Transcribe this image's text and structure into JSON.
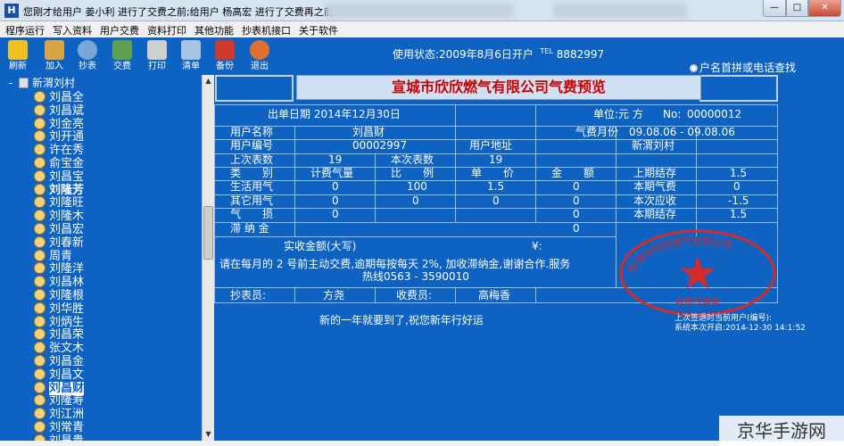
{
  "window": {
    "title": "您刚才给用户 姜小利 进行了交费之前;给用户 杨高宏 进行了交费再之前:",
    "min": "—",
    "max": "□",
    "close": "✕"
  },
  "menu": [
    "程序运行",
    "写入资料",
    "用户交费",
    "资料打印",
    "其他功能",
    "抄表机接口",
    "关于软件"
  ],
  "toolbar": [
    {
      "label": "刷新",
      "icon": "lightbulb-icon",
      "color": "#f0c020"
    },
    {
      "label": "加入",
      "icon": "add-user-icon",
      "color": "#d9a441"
    },
    {
      "label": "抄表",
      "icon": "meter-icon",
      "color": "#7aa7d6"
    },
    {
      "label": "交费",
      "icon": "calculator-icon",
      "color": "#5f9f4f"
    },
    {
      "label": "打印",
      "icon": "printer-icon",
      "color": "#cfcfcf"
    },
    {
      "label": "清单",
      "icon": "list-icon",
      "color": "#a9c3e3"
    },
    {
      "label": "备份",
      "icon": "backup-icon",
      "color": "#cf3a2a"
    },
    {
      "label": "退出",
      "icon": "exit-icon",
      "color": "#e07030"
    }
  ],
  "status": {
    "text": "使用状态:2009年8月6日开户",
    "tel_label": "TEL",
    "phone": "8882997"
  },
  "search_option": "户名首拼或电话查找",
  "tree": {
    "root": "新渭刘村",
    "expander": "-",
    "items": [
      "刘昌全",
      "刘昌斌",
      "刘金亮",
      "刘开通",
      "许在秀",
      "俞宝金",
      "刘昌宝",
      "刘隆芳",
      "刘隆旺",
      "刘隆木",
      "刘昌宏",
      "刘春新",
      "周青",
      "刘隆洋",
      "刘昌林",
      "刘隆根",
      "刘华胜",
      "刘炳生",
      "刘昌荣",
      "张文木",
      "刘昌金",
      "刘昌文",
      "刘昌财",
      "刘隆寿",
      "刘江洲",
      "刘常青",
      "刘昌贵"
    ]
  },
  "scroll": {
    "up": "▲",
    "down": "▼"
  },
  "bill": {
    "title": "宣城市欣欣燃气有限公司气费预览",
    "issue_date": "出单日期 2014年12月30日",
    "unit": "单位:元 方",
    "no_label": "No:",
    "no": "00000012",
    "user_name_label": "用户名称",
    "user_name": "刘昌财",
    "billing_month_label": "气费月份",
    "billing_month": "09.08.06 - 09.08.06",
    "user_no_label": "用户编号",
    "user_no": "00002997",
    "address_label": "用户地址",
    "address": "新渭刘村",
    "last_reading_label": "上次表数",
    "last_reading": "19",
    "this_reading_label": "本次表数",
    "this_reading": "19",
    "col_category": "类　　别",
    "col_volume": "计费气量",
    "col_ratio": "比　　例",
    "col_price": "单　　价",
    "col_amount": "金　　额",
    "row_living": "生活用气",
    "living_volume": "0",
    "living_ratio": "100",
    "living_price": "1.5",
    "living_amount": "0",
    "row_other": "其它用气",
    "other_volume": "0",
    "other_ratio": "0",
    "other_price": "0",
    "other_amount": "0",
    "row_loss": "气　　损",
    "loss_volume": "0",
    "loss_amount": "0",
    "row_late_fee": "滞 纳 金",
    "late_fee_amount": "0",
    "prev_balance_label": "上期结存",
    "prev_balance": "1.5",
    "this_fee_label": "本期气费",
    "this_fee": "0",
    "this_due_label": "本次应收",
    "this_due": "-1.5",
    "curr_balance_label": "本期结存",
    "curr_balance": "1.5",
    "received_label": "实收金额(大写)",
    "yuan_sign": "¥:",
    "notice_line1": "请在每月的 2 号前主动交费,逾期每按每天 2%, 加收滞纳金,谢谢合作.服务",
    "notice_line2": "热线0563 - 3590010",
    "reader_label": "抄表员:",
    "reader": "方尧",
    "collector_label": "收费员:",
    "collector": "高梅香"
  },
  "stamp": {
    "org": "宣城市欣欣燃气有限公司",
    "purpose": "收费专用章",
    "color": "#d22b2b"
  },
  "footer": {
    "greeting": "新的一年就要到了,祝您新年行好运",
    "last_sign_label": "上次签退时当前用户(编号):",
    "open_time": "系统本次开启:2014-12-30 14:1:52"
  },
  "watermark": "京华手游网"
}
